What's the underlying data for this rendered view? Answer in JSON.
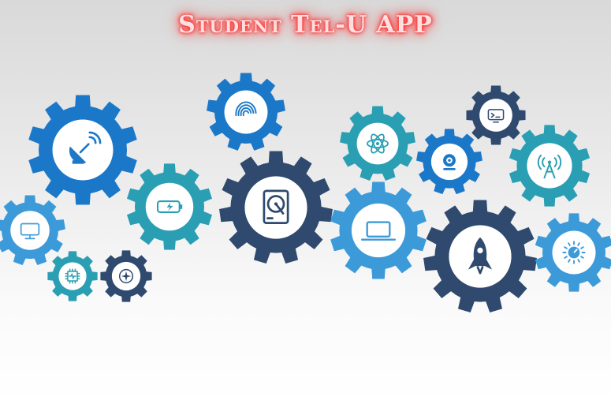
{
  "title": "Student Tel-U APP",
  "colors": {
    "blue": "#1b78c8",
    "teal": "#2a9fb3",
    "navy": "#2f4a6e",
    "light_blue": "#3d9ad9"
  },
  "gears": [
    {
      "icon": "satellite-dish-icon",
      "color": "blue"
    },
    {
      "icon": "fingerprint-icon",
      "color": "blue"
    },
    {
      "icon": "atom-icon",
      "color": "teal"
    },
    {
      "icon": "terminal-icon",
      "color": "navy"
    },
    {
      "icon": "webcam-icon",
      "color": "blue"
    },
    {
      "icon": "antenna-icon",
      "color": "teal"
    },
    {
      "icon": "battery-charging-icon",
      "color": "teal"
    },
    {
      "icon": "hard-drive-icon",
      "color": "navy"
    },
    {
      "icon": "laptop-icon",
      "color": "light_blue"
    },
    {
      "icon": "rocket-icon",
      "color": "navy"
    },
    {
      "icon": "volume-knob-icon",
      "color": "light_blue"
    },
    {
      "icon": "desktop-computer-icon",
      "color": "light_blue"
    },
    {
      "icon": "cpu-chip-icon",
      "color": "teal"
    },
    {
      "icon": "compass-icon",
      "color": "navy"
    }
  ]
}
